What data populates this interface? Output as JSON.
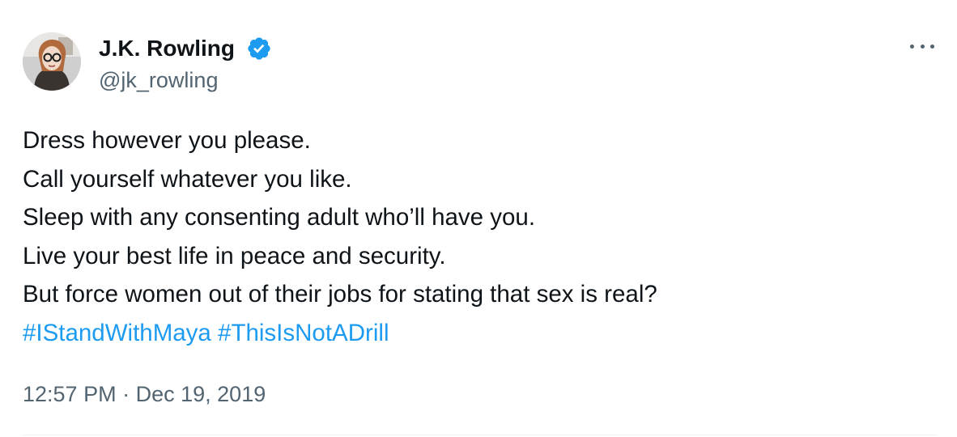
{
  "author": {
    "name": "J.K. Rowling",
    "handle": "@jk_rowling",
    "verified": true
  },
  "tweet": {
    "lines": [
      "Dress however you please.",
      "Call yourself whatever you like.",
      "Sleep with any consenting adult who’ll have you.",
      "Live your best life in peace and security.",
      "But force women out of their jobs for stating that sex is real?"
    ],
    "hashtags": [
      "#IStandWithMaya",
      "#ThisIsNotADrill"
    ]
  },
  "meta": {
    "time": "12:57 PM",
    "separator": "·",
    "date": "Dec 19, 2019"
  },
  "icons": {
    "verified": "verified-badge-icon",
    "more": "more-options-icon"
  },
  "colors": {
    "text": "#0f1419",
    "secondary": "#536471",
    "link": "#1d9bf0",
    "verified": "#1d9bf0",
    "divider": "#eff3f4"
  }
}
